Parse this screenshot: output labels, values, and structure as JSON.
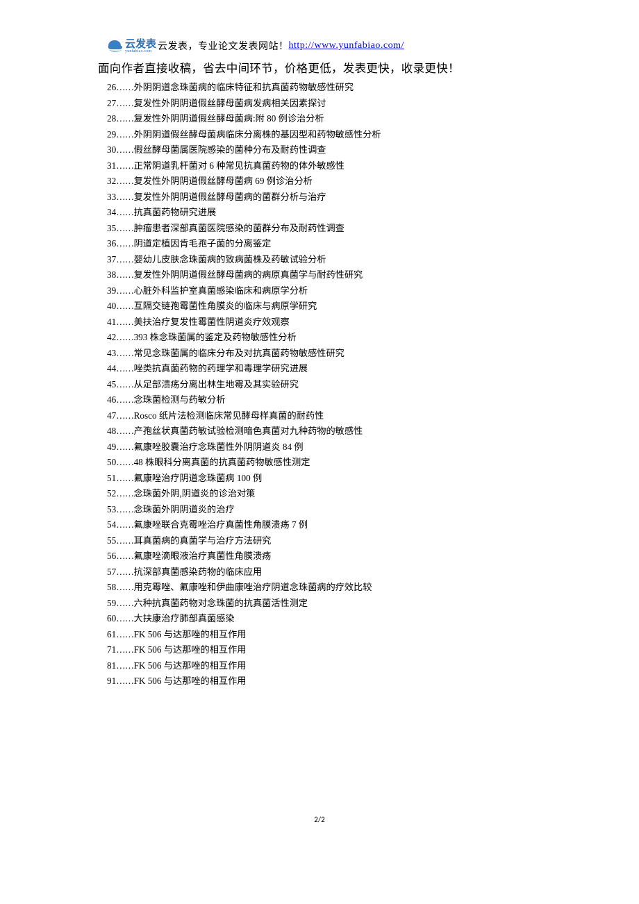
{
  "header": {
    "logo_cn": "云发表",
    "logo_py": "yunfabiao.com",
    "tagline": " 云发表，专业论文发表网站！",
    "link_text": "http://www.yunfabiao.com/",
    "subhead": "面向作者直接收稿，省去中间环节，价格更低，发表更快，收录更快！"
  },
  "toc": [
    {
      "num": "26",
      "title": "外阴阴道念珠菌病的临床特征和抗真菌药物敏感性研究"
    },
    {
      "num": "27",
      "title": "复发性外阴阴道假丝酵母菌病发病相关因素探讨"
    },
    {
      "num": "28",
      "title": "复发性外阴阴道假丝酵母菌病:附 80 例诊治分析"
    },
    {
      "num": "29",
      "title": "外阴阴道假丝酵母菌病临床分离株的基因型和药物敏感性分析"
    },
    {
      "num": "30",
      "title": "假丝酵母菌属医院感染的菌种分布及耐药性调查"
    },
    {
      "num": "31",
      "title": "正常阴道乳杆菌对 6 种常见抗真菌药物的体外敏感性"
    },
    {
      "num": "32",
      "title": "复发性外阴阴道假丝酵母菌病 69 例诊治分析"
    },
    {
      "num": "33",
      "title": "复发性外阴阴道假丝酵母菌病的菌群分析与治疗"
    },
    {
      "num": "34",
      "title": "抗真菌药物研究进展"
    },
    {
      "num": "35",
      "title": "肿瘤患者深部真菌医院感染的菌群分布及耐药性调查"
    },
    {
      "num": "36",
      "title": "阴道定植因肯毛孢子菌的分离鉴定"
    },
    {
      "num": "37",
      "title": "婴幼儿皮肤念珠菌病的致病菌株及药敏试验分析"
    },
    {
      "num": "38",
      "title": "复发性外阴阴道假丝酵母菌病的病原真菌学与耐药性研究"
    },
    {
      "num": "39",
      "title": "心脏外科监护室真菌感染临床和病原学分析"
    },
    {
      "num": "40",
      "title": "互隔交链孢霉菌性角膜炎的临床与病原学研究"
    },
    {
      "num": "41",
      "title": "美扶治疗复发性霉菌性阴道炎疗效观察"
    },
    {
      "num": "42",
      "title": "393 株念珠菌属的鉴定及药物敏感性分析"
    },
    {
      "num": "43",
      "title": "常见念珠菌属的临床分布及对抗真菌药物敏感性研究"
    },
    {
      "num": "44",
      "title": "唑类抗真菌药物的药理学和毒理学研究进展"
    },
    {
      "num": "45",
      "title": "从足部溃疡分离出林生地霉及其实验研究"
    },
    {
      "num": "46",
      "title": "念珠菌检测与药敏分析"
    },
    {
      "num": "47",
      "title": "Rosco 纸片法检测临床常见酵母样真菌的耐药性"
    },
    {
      "num": "48",
      "title": "产孢丝状真菌药敏试验检测暗色真菌对九种药物的敏感性"
    },
    {
      "num": "49",
      "title": "氟康唑胶囊治疗念珠菌性外阴阴道炎  84 例"
    },
    {
      "num": "50",
      "title": "48 株眼科分离真菌的抗真菌药物敏感性测定"
    },
    {
      "num": "51",
      "title": "氟康唑治疗阴道念珠菌病 100 例"
    },
    {
      "num": "52",
      "title": "念珠菌外阴,阴道炎的诊治对策"
    },
    {
      "num": "53",
      "title": "念珠菌外阴阴道炎的治疗"
    },
    {
      "num": "54",
      "title": "氟康唑联合克霉唑治疗真菌性角膜溃疡 7 例"
    },
    {
      "num": "55",
      "title": "耳真菌病的真菌学与治疗方法研究"
    },
    {
      "num": "56",
      "title": "氟康唑滴眼液治疗真菌性角膜溃疡"
    },
    {
      "num": "57",
      "title": "抗深部真菌感染药物的临床应用"
    },
    {
      "num": "58",
      "title": "用克霉唑、氟康唑和伊曲康唑治疗阴道念珠菌病的疗效比较"
    },
    {
      "num": "59",
      "title": "六种抗真菌药物对念珠菌的抗真菌活性测定"
    },
    {
      "num": "60",
      "title": "大扶康治疗肺部真菌感染"
    },
    {
      "num": "61",
      "title": "FK 506 与达那唑的相互作用"
    },
    {
      "num": "71",
      "title": "FK 506 与达那唑的相互作用"
    },
    {
      "num": "81",
      "title": "FK 506 与达那唑的相互作用"
    },
    {
      "num": "91",
      "title": "FK 506 与达那唑的相互作用"
    }
  ],
  "footer": {
    "page": "2/2"
  }
}
